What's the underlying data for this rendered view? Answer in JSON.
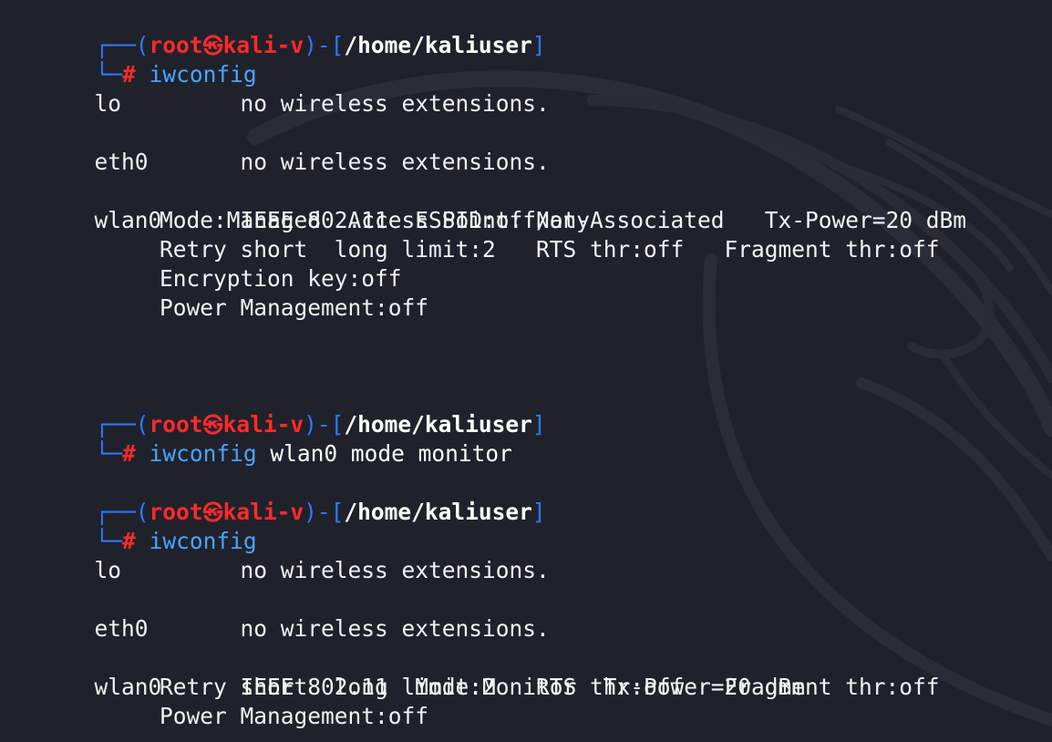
{
  "prompt": {
    "user": "root",
    "host": "kali-v",
    "path": "/home/kaliuser",
    "symbol": "#",
    "skull": "㉿"
  },
  "block1": {
    "command": "iwconfig",
    "lo_iface": "lo",
    "lo_text": "no wireless extensions.",
    "eth_iface": "eth0",
    "eth_text": "no wireless extensions.",
    "wlan_iface": "wlan0",
    "wlan_lines": [
      "IEEE 802.11  ESSID:off/any",
      "Mode:Managed  Access Point: Not-Associated   Tx-Power=20 dBm",
      "Retry short  long limit:2   RTS thr:off   Fragment thr:off",
      "Encryption key:off",
      "Power Management:off"
    ]
  },
  "block2": {
    "command": "iwconfig",
    "args": "wlan0 mode monitor"
  },
  "block3": {
    "command": "iwconfig",
    "lo_iface": "lo",
    "lo_text": "no wireless extensions.",
    "eth_iface": "eth0",
    "eth_text": "no wireless extensions.",
    "wlan_iface": "wlan0",
    "wlan_lines": [
      "IEEE 802.11  Mode:Monitor  Tx-Power=20 dBm",
      "Retry short  long limit:2   RTS thr:off   Fragment thr:off",
      "Power Management:off"
    ]
  },
  "colors": {
    "background": "#20222b",
    "user_host": "#ff2a2a",
    "bracket": "#2f78ff",
    "command": "#4aa3ff",
    "path": "#ffffff"
  },
  "icons": {
    "background_logo": "kali-dragon-icon"
  }
}
